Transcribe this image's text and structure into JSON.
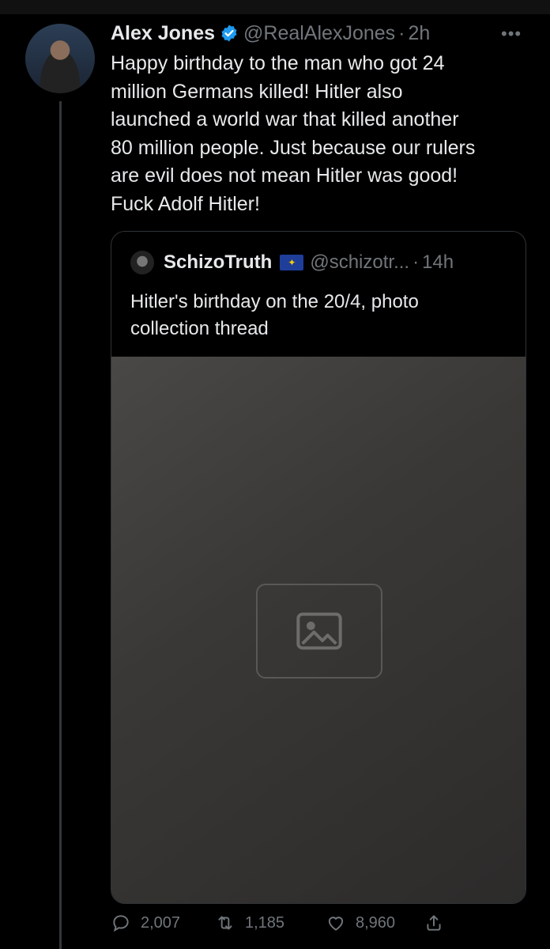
{
  "tweet": {
    "author_name": "Alex Jones",
    "handle": "@RealAlexJones",
    "separator": "·",
    "time": "2h",
    "more_label": "•••",
    "text_lines": [
      "Happy birthday to the man who got 24",
      "million Germans killed! Hitler also",
      "launched a world war that killed another",
      "80 million people. Just because our rulers",
      "are evil does not mean Hitler was good!",
      "Fuck Adolf Hitler!"
    ]
  },
  "quoted_tweet": {
    "author_name": "SchizoTruth",
    "flag_icon": "eu-flag-icon",
    "handle": "@schizotr...",
    "separator": "·",
    "time": "14h",
    "text_lines": [
      "Hitler's birthday on the 20/4, photo",
      "collection thread"
    ],
    "media_icon": "photo-icon"
  },
  "actions": {
    "reply_count": "2,007",
    "retweet_count": "1,185",
    "like_count": "8,960"
  },
  "colors": {
    "background": "#000000",
    "text": "#e7e9ea",
    "muted": "#71767b",
    "border": "#2f3336",
    "verified": "#1d9bf0"
  }
}
